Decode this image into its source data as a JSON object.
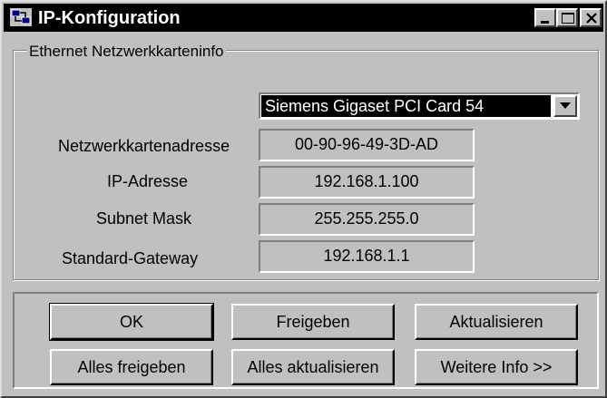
{
  "window": {
    "title": "IP-Konfiguration"
  },
  "group": {
    "legend": "Ethernet  Netzwerkkarteninfo"
  },
  "adapter": {
    "selected": "Siemens Gigaset PCI Card 54"
  },
  "fields": [
    {
      "label": "Netzwerkkartenadresse",
      "value": "00-90-96-49-3D-AD"
    },
    {
      "label": "IP-Adresse",
      "value": "192.168.1.100"
    },
    {
      "label": "Subnet Mask",
      "value": "255.255.255.0"
    },
    {
      "label": "Standard-Gateway",
      "value": "192.168.1.1"
    }
  ],
  "buttons": {
    "ok": "OK",
    "release": "Freigeben",
    "renew": "Aktualisieren",
    "release_all": "Alles freigeben",
    "renew_all": "Alles aktualisieren",
    "more_info": "Weitere Info >>"
  },
  "colors": {
    "face": "#c0c0c0",
    "titlebar": "#000000",
    "selection": "#000000"
  },
  "icons": {
    "app": "network-config-icon",
    "minimize": "minimize-icon",
    "maximize": "maximize-icon",
    "close": "close-icon",
    "dropdown": "chevron-down-icon"
  }
}
